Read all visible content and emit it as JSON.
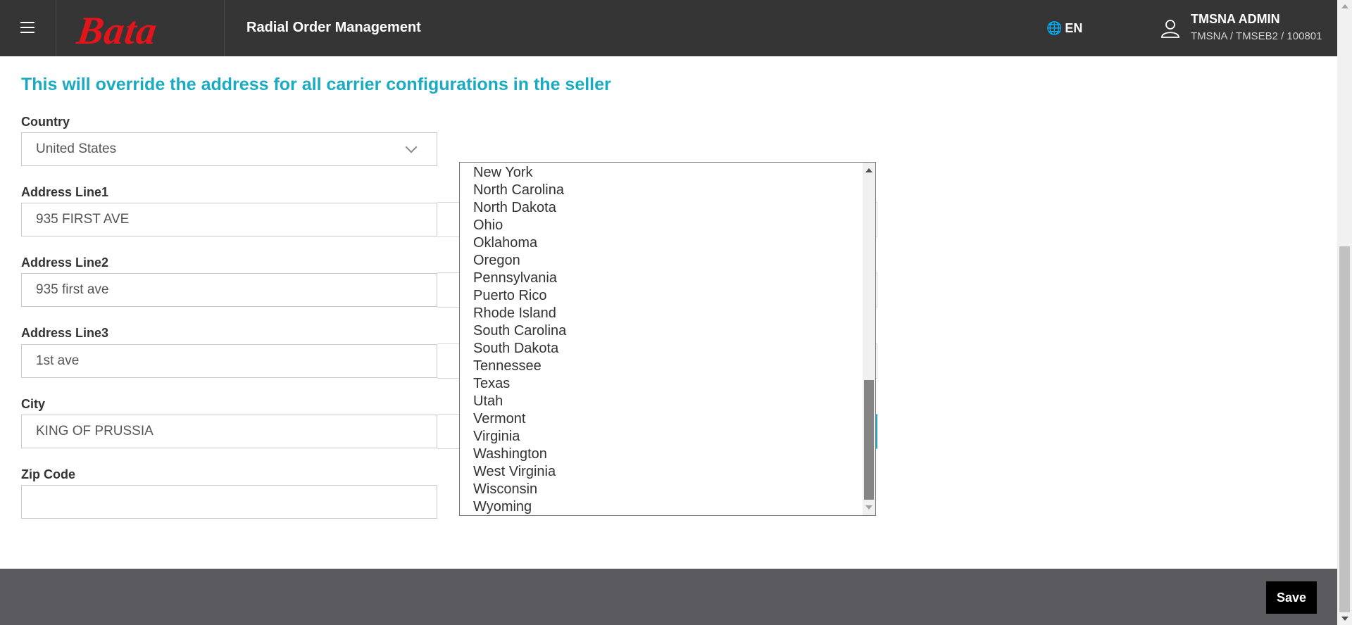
{
  "header": {
    "logo_text": "Bata",
    "app_title": "Radial Order Management",
    "language": "EN",
    "user_name": "TMSNA ADMIN",
    "user_path": "TMSNA / TMSEB2 / 100801"
  },
  "notice": "This will override the address for all carrier configurations in the seller",
  "form": {
    "country_label": "Country",
    "country_value": "United States",
    "address1_label": "Address Line1",
    "address1_value": "935 FIRST AVE",
    "address2_label": "Address Line2",
    "address2_value": "935 first ave",
    "address3_label": "Address Line3",
    "address3_value": "1st ave",
    "city_label": "City",
    "city_value": "KING OF PRUSSIA",
    "zip_label": "Zip Code",
    "zip_value": ""
  },
  "state_dropdown": {
    "options": [
      "New York",
      "North Carolina",
      "North Dakota",
      "Ohio",
      "Oklahoma",
      "Oregon",
      "Pennsylvania",
      "Puerto Rico",
      "Rhode Island",
      "South Carolina",
      "South Dakota",
      "Tennessee",
      "Texas",
      "Utah",
      "Vermont",
      "Virginia",
      "Washington",
      "West Virginia",
      "Wisconsin",
      "Wyoming"
    ]
  },
  "footer": {
    "save_label": "Save"
  },
  "colors": {
    "accent": "#1aabc2",
    "header_bg": "#353535",
    "logo_red": "#e3151b",
    "footer_bg": "#5b5b5f"
  }
}
